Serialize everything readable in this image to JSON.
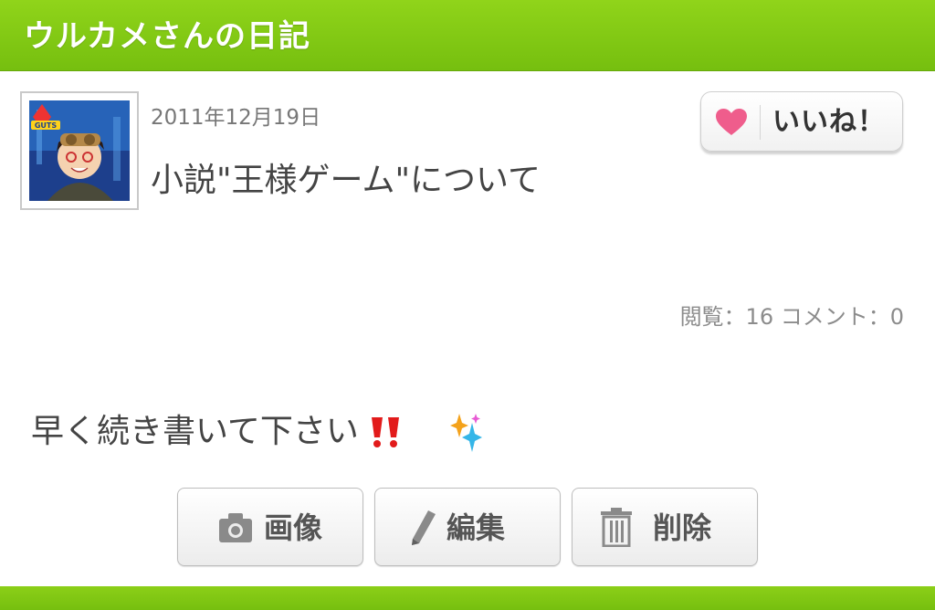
{
  "header": {
    "title": "ウルカメさんの日記"
  },
  "post": {
    "date": "2011年12月19日",
    "title": "小説\"王様ゲーム\"について",
    "stats": "閲覧：16 コメント：0",
    "body": "早く続き書いて下さい"
  },
  "like_button": {
    "label": "いいね！"
  },
  "actions": {
    "image_label": "画像",
    "edit_label": "編集",
    "delete_label": "削除"
  },
  "avatar_badge": "GUTS",
  "icons": {
    "like": "heart-icon",
    "image": "camera-icon",
    "edit": "pencil-icon",
    "delete": "trash-icon",
    "emoji_1": "double-exclamation-icon",
    "emoji_2": "sparkle-icon"
  },
  "colors": {
    "header_green": "#82c911",
    "heart_pink": "#ef5d8c",
    "exclamation_red": "#e21b1b"
  }
}
